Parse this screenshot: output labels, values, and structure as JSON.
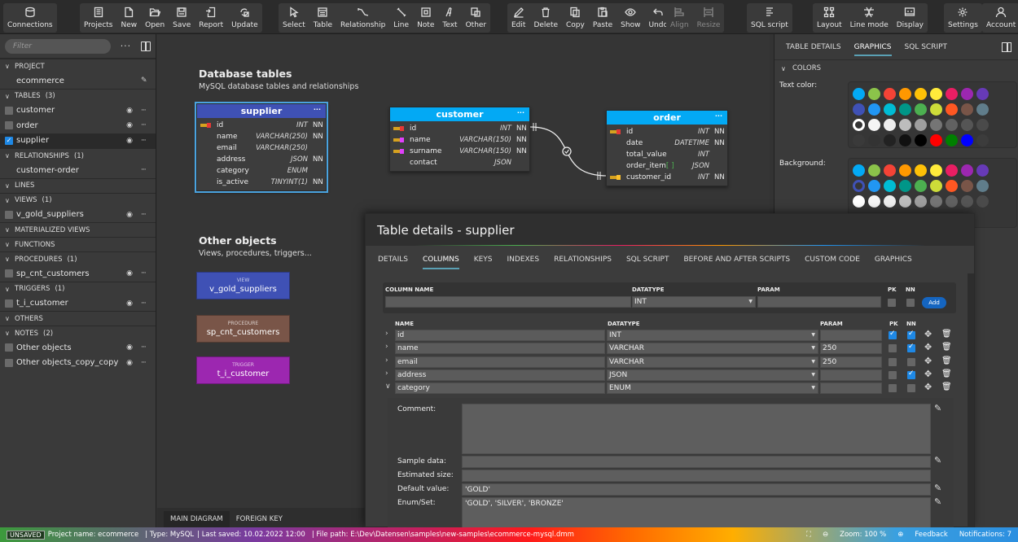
{
  "toolbar": {
    "groups": [
      {
        "items": [
          {
            "label": "Connections",
            "icon": "database-icon"
          }
        ]
      },
      {
        "items": [
          {
            "label": "Projects",
            "icon": "projects-icon"
          },
          {
            "label": "New",
            "icon": "new-file-icon"
          },
          {
            "label": "Open",
            "icon": "folder-open-icon"
          },
          {
            "label": "Save",
            "icon": "save-icon"
          },
          {
            "label": "Report",
            "icon": "report-icon"
          },
          {
            "label": "Update",
            "icon": "update-icon"
          }
        ]
      },
      {
        "items": [
          {
            "label": "Select",
            "icon": "cursor-icon"
          },
          {
            "label": "Table",
            "icon": "table-icon"
          },
          {
            "label": "Relationship",
            "icon": "relationship-icon"
          },
          {
            "label": "Line",
            "icon": "line-icon"
          },
          {
            "label": "Note",
            "icon": "note-icon"
          },
          {
            "label": "Text",
            "icon": "text-icon"
          },
          {
            "label": "Other",
            "icon": "other-icon"
          }
        ]
      },
      {
        "items": [
          {
            "label": "Edit",
            "icon": "pencil-icon"
          },
          {
            "label": "Delete",
            "icon": "trash-icon"
          },
          {
            "label": "Copy",
            "icon": "copy-icon"
          },
          {
            "label": "Paste",
            "icon": "paste-icon"
          },
          {
            "label": "Show",
            "icon": "eye-icon"
          },
          {
            "label": "Undo",
            "icon": "undo-icon"
          }
        ]
      },
      {
        "items": [
          {
            "label": "Align",
            "icon": "align-icon",
            "disabled": true
          },
          {
            "label": "Resize",
            "icon": "resize-icon",
            "disabled": true
          }
        ]
      },
      {
        "items": [
          {
            "label": "SQL script",
            "icon": "sql-script-icon"
          }
        ]
      },
      {
        "items": [
          {
            "label": "Layout",
            "icon": "layout-icon"
          },
          {
            "label": "Line mode",
            "icon": "line-mode-icon"
          },
          {
            "label": "Display",
            "icon": "display-icon"
          }
        ]
      },
      {
        "items": [
          {
            "label": "Settings",
            "icon": "gear-icon"
          }
        ]
      },
      {
        "items": [
          {
            "label": "Account",
            "icon": "user-icon"
          }
        ]
      }
    ]
  },
  "sidebar": {
    "filter_placeholder": "Filter",
    "sections": [
      {
        "title": "PROJECT",
        "count": "",
        "items": [
          {
            "name": "ecommerce",
            "type": "project"
          }
        ]
      },
      {
        "title": "TABLES",
        "count": "(3)",
        "items": [
          {
            "name": "customer",
            "checked": false
          },
          {
            "name": "order",
            "checked": false
          },
          {
            "name": "supplier",
            "checked": true,
            "selected": true
          }
        ]
      },
      {
        "title": "RELATIONSHIPS",
        "count": "(1)",
        "items": [
          {
            "name": "customer-order",
            "type": "relation"
          }
        ]
      },
      {
        "title": "LINES",
        "count": "",
        "items": []
      },
      {
        "title": "VIEWS",
        "count": "(1)",
        "items": [
          {
            "name": "v_gold_suppliers",
            "checked": false
          }
        ]
      },
      {
        "title": "MATERIALIZED VIEWS",
        "count": "",
        "items": []
      },
      {
        "title": "FUNCTIONS",
        "count": "",
        "items": []
      },
      {
        "title": "PROCEDURES",
        "count": "(1)",
        "items": [
          {
            "name": "sp_cnt_customers",
            "checked": false
          }
        ]
      },
      {
        "title": "TRIGGERS",
        "count": "(1)",
        "items": [
          {
            "name": "t_i_customer",
            "checked": false
          }
        ]
      },
      {
        "title": "OTHERS",
        "count": "",
        "items": []
      },
      {
        "title": "NOTES",
        "count": "(2)",
        "items": [
          {
            "name": "Other objects",
            "checked": false
          },
          {
            "name": "Other objects_copy_copy",
            "checked": false
          }
        ]
      }
    ]
  },
  "canvas": {
    "db_title": "Database tables",
    "db_subtitle": "MySQL database tables and relationships",
    "other_title": "Other objects",
    "other_subtitle": "Views, procedures, triggers...",
    "tables": {
      "supplier": {
        "name": "supplier",
        "color": "#3f51b5",
        "columns": [
          {
            "name": "id",
            "type": "INT",
            "nn": "NN",
            "key": "pk"
          },
          {
            "name": "name",
            "type": "VARCHAR(250)",
            "nn": "NN",
            "key": ""
          },
          {
            "name": "email",
            "type": "VARCHAR(250)",
            "nn": "",
            "key": ""
          },
          {
            "name": "address",
            "type": "JSON",
            "nn": "NN",
            "key": ""
          },
          {
            "name": "category",
            "type": "ENUM",
            "nn": "",
            "key": ""
          },
          {
            "name": "is_active",
            "type": "TINYINT(1)",
            "nn": "NN",
            "key": ""
          }
        ]
      },
      "customer": {
        "name": "customer",
        "color": "#03a9f4",
        "columns": [
          {
            "name": "id",
            "type": "INT",
            "nn": "NN",
            "key": "pk"
          },
          {
            "name": "name",
            "type": "VARCHAR(150)",
            "nn": "NN",
            "key": "idx"
          },
          {
            "name": "surname",
            "type": "VARCHAR(150)",
            "nn": "NN",
            "key": "idx"
          },
          {
            "name": "contact",
            "type": "JSON",
            "nn": "",
            "key": ""
          }
        ]
      },
      "order": {
        "name": "order",
        "color": "#03a9f4",
        "columns": [
          {
            "name": "id",
            "type": "INT",
            "nn": "NN",
            "key": "pk"
          },
          {
            "name": "date",
            "type": "DATETIME",
            "nn": "NN",
            "key": ""
          },
          {
            "name": "total_value",
            "type": "INT",
            "nn": "",
            "key": ""
          },
          {
            "name": "order_item",
            "suffix": "[ ]",
            "type": "JSON",
            "nn": "",
            "key": ""
          },
          {
            "name": "customer_id",
            "type": "INT",
            "nn": "NN",
            "key": "fk"
          }
        ]
      }
    },
    "objects": [
      {
        "label": "VIEW",
        "name": "v_gold_suppliers",
        "color": "#3f51b5"
      },
      {
        "label": "PROCEDURE",
        "name": "sp_cnt_customers",
        "color": "#795548"
      },
      {
        "label": "TRIGGER",
        "name": "t_i_customer",
        "color": "#9c27b0"
      }
    ],
    "tabs": [
      {
        "label": "MAIN DIAGRAM",
        "active": true
      },
      {
        "label": "FOREIGN KEY",
        "active": false
      }
    ]
  },
  "right_panel": {
    "tabs": [
      {
        "label": "TABLE DETAILS",
        "active": false
      },
      {
        "label": "GRAPHICS",
        "active": true
      },
      {
        "label": "SQL SCRIPT",
        "active": false
      }
    ],
    "section": "COLORS",
    "text_color_label": "Text color:",
    "background_label": "Background:",
    "palette": [
      [
        "#03a9f4",
        "#8bc34a",
        "#f44336",
        "#ff9800",
        "#ffc107",
        "#ffeb3b",
        "#e91e63",
        "#9c27b0",
        "#673ab7"
      ],
      [
        "#3f51b5",
        "#2196f3",
        "#00bcd4",
        "#009688",
        "#4caf50",
        "#cddc39",
        "#ff5722",
        "#795548",
        "#607d8b"
      ],
      [
        "#ffffff",
        "#f5f5f5",
        "#eeeeee",
        "#bdbdbd",
        "#9e9e9e",
        "#757575",
        "#616161",
        "#555555",
        "#4a4a4a"
      ],
      [
        "#3a3a3a",
        "#333333",
        "#222222",
        "#111111",
        "#000000",
        "#ff0000",
        "#008000",
        "#0000ff",
        "#3c3c3c"
      ]
    ]
  },
  "dialog": {
    "title": "Table details - supplier",
    "tabs": [
      {
        "label": "DETAILS"
      },
      {
        "label": "COLUMNS",
        "active": true
      },
      {
        "label": "KEYS"
      },
      {
        "label": "INDEXES"
      },
      {
        "label": "RELATIONSHIPS"
      },
      {
        "label": "SQL SCRIPT"
      },
      {
        "label": "BEFORE AND AFTER SCRIPTS"
      },
      {
        "label": "CUSTOM CODE"
      },
      {
        "label": "GRAPHICS"
      }
    ],
    "new_column": {
      "name_label": "COLUMN NAME",
      "datatype_label": "DATATYPE",
      "param_label": "PARAM",
      "pk_label": "PK",
      "nn_label": "NN",
      "name_value": "",
      "datatype_value": "INT",
      "param_value": "",
      "add_label": "Add"
    },
    "columns_header": {
      "name": "NAME",
      "datatype": "DATATYPE",
      "param": "PARAM",
      "pk": "PK",
      "nn": "NN"
    },
    "columns": [
      {
        "name": "id",
        "datatype": "INT",
        "param": "",
        "pk": true,
        "nn": true,
        "expanded": false
      },
      {
        "name": "name",
        "datatype": "VARCHAR",
        "param": "250",
        "pk": false,
        "nn": true,
        "expanded": false
      },
      {
        "name": "email",
        "datatype": "VARCHAR",
        "param": "250",
        "pk": false,
        "nn": false,
        "expanded": false
      },
      {
        "name": "address",
        "datatype": "JSON",
        "param": "",
        "pk": false,
        "nn": true,
        "expanded": false
      },
      {
        "name": "category",
        "datatype": "ENUM",
        "param": "",
        "pk": false,
        "nn": false,
        "expanded": true
      }
    ],
    "detail": {
      "comment_label": "Comment:",
      "comment_value": "",
      "sample_label": "Sample data:",
      "sample_value": "",
      "size_label": "Estimated size:",
      "size_value": "",
      "default_label": "Default value:",
      "default_value": "'GOLD'",
      "enum_label": "Enum/Set:",
      "enum_value": "'GOLD', 'SILVER', 'BRONZE'"
    }
  },
  "status": {
    "unsaved": "UNSAVED",
    "project": "Project name: ecommerce",
    "type": "| Type: MySQL",
    "saved": "| Last saved: 10.02.2022 12:00",
    "path": "| File path: E:\\Dev\\Datensen\\samples\\new-samples\\ecommerce-mysql.dmm",
    "zoom": "Zoom: 100 %",
    "feedback": "Feedback",
    "notifications": "Notifications: 7"
  }
}
